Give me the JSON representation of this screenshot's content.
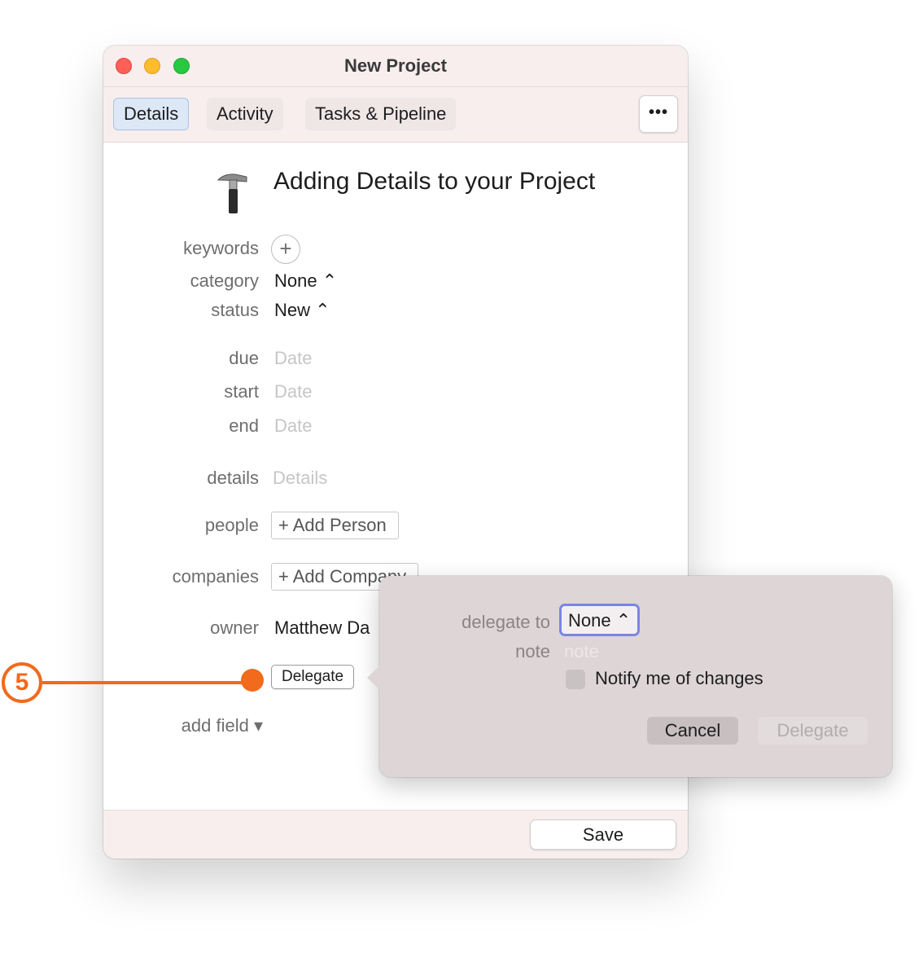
{
  "window": {
    "title": "New Project",
    "tabs": [
      {
        "label": "Details",
        "active": true
      },
      {
        "label": "Activity",
        "active": false
      },
      {
        "label": "Tasks & Pipeline",
        "active": false
      }
    ],
    "more_button": "•••",
    "heading": "Adding Details to your Project",
    "heading_icon": "hammer-icon"
  },
  "form": {
    "keywords_label": "keywords",
    "keywords_add": "+",
    "category_label": "category",
    "category_value": "None ⌃",
    "status_label": "status",
    "status_value": "New ⌃",
    "due_label": "due",
    "due_placeholder": "Date",
    "start_label": "start",
    "start_placeholder": "Date",
    "end_label": "end",
    "end_placeholder": "Date",
    "details_label": "details",
    "details_placeholder": "Details",
    "people_label": "people",
    "people_button": "+ Add Person",
    "companies_label": "companies",
    "companies_button": "+ Add Company",
    "owner_label": "owner",
    "owner_value": "Matthew Da",
    "delegate_button": "Delegate",
    "add_field": "add field ▾"
  },
  "footer": {
    "save_label": "Save"
  },
  "popover": {
    "delegate_to_label": "delegate to",
    "delegate_to_value": "None ⌃",
    "note_label": "note",
    "note_placeholder": "note",
    "notify_label": "Notify me of changes",
    "notify_checked": false,
    "cancel_label": "Cancel",
    "delegate_label": "Delegate"
  },
  "callout": {
    "number": "5",
    "color": "#f26a1b"
  },
  "colors": {
    "titlebar": "#f8eeee",
    "popover": "#ddd5d6",
    "focus_ring": "#7a86e0"
  }
}
